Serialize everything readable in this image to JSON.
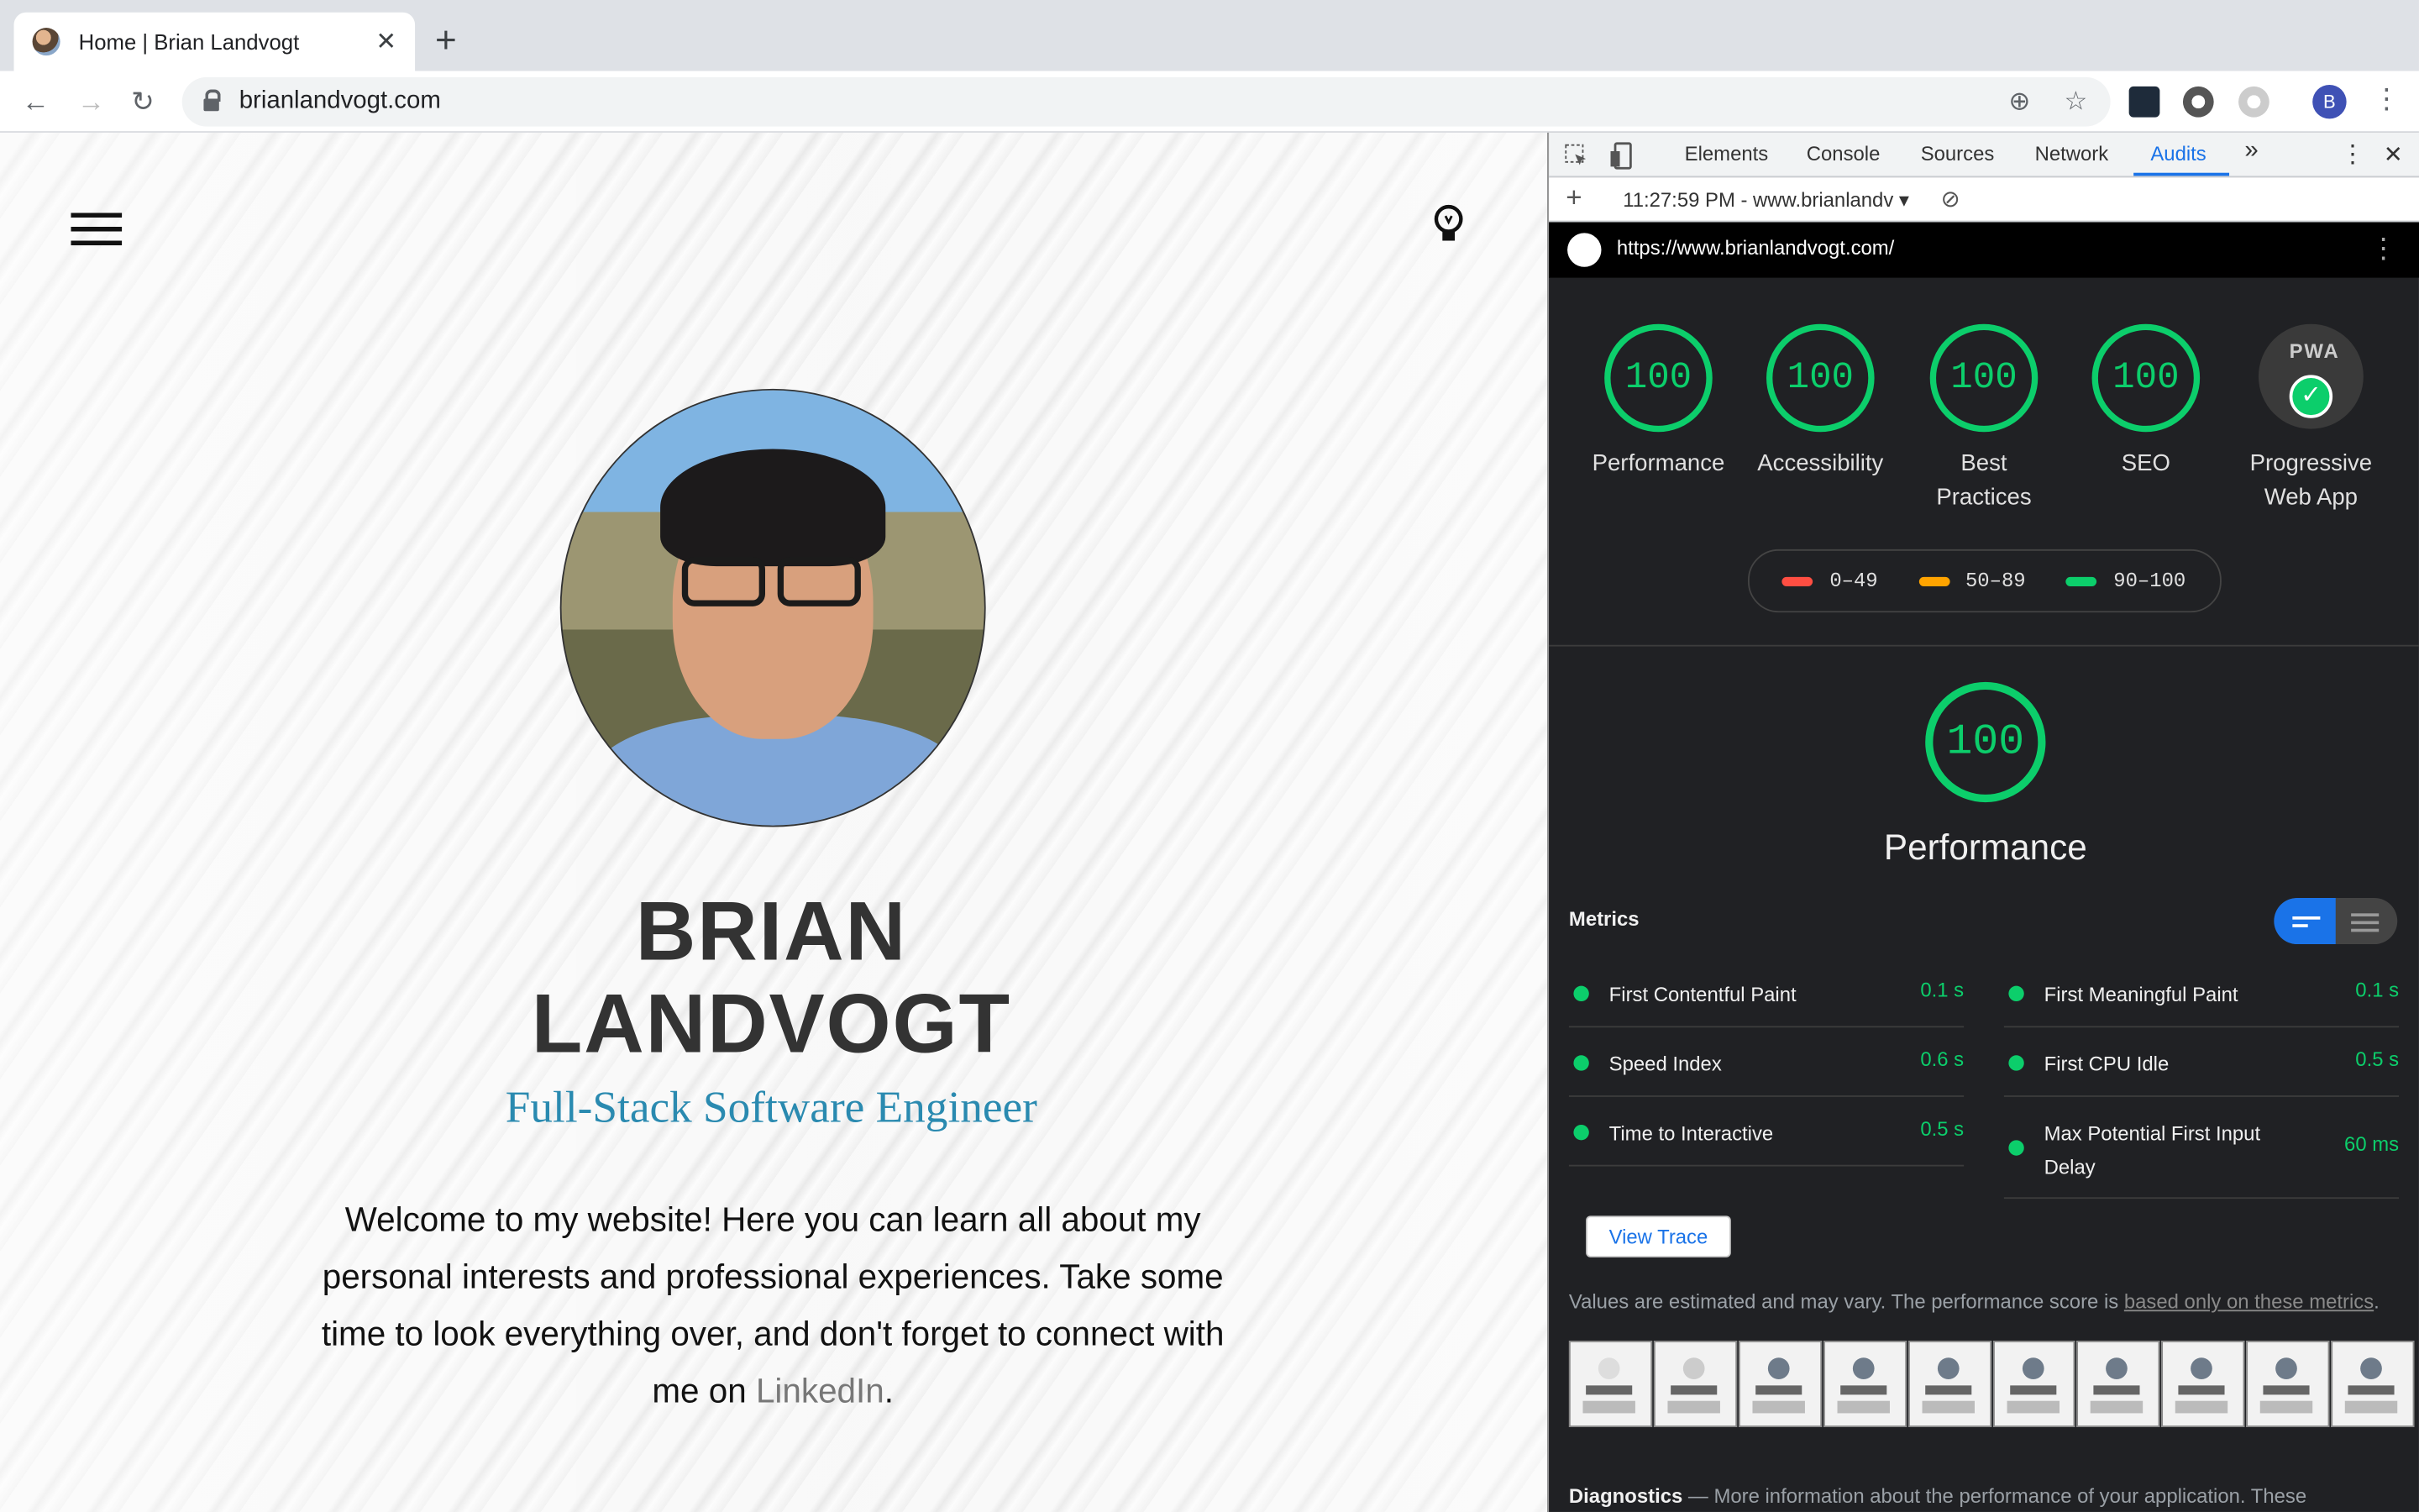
{
  "browser": {
    "tab_title": "Home | Brian Landvogt",
    "url": "brianlandvogt.com",
    "profile_initial": "B"
  },
  "site": {
    "name_line1": "BRIAN",
    "name_line2": "LANDVOGT",
    "role": "Full-Stack Software Engineer",
    "welcome_text": "Welcome to my website! Here you can learn all about my personal interests and professional experiences. Take some time to look everything over, and don't forget to connect with me on",
    "linkedin_label": "LinkedIn",
    "period": "."
  },
  "devtools": {
    "tabs": [
      "Elements",
      "Console",
      "Sources",
      "Network",
      "Audits"
    ],
    "active_tab": "Audits",
    "more": "»",
    "report_selector": "11:27:59 PM - www.brianlandv",
    "report_url": "https://www.brianlandvogt.com/",
    "scores": [
      {
        "label": "Performance",
        "value": "100"
      },
      {
        "label": "Accessibility",
        "value": "100"
      },
      {
        "label": "Best\nPractices",
        "value": "100"
      },
      {
        "label": "SEO",
        "value": "100"
      }
    ],
    "pwa": {
      "badge": "PWA",
      "label": "Progressive\nWeb App"
    },
    "legend": [
      {
        "range": "0–49",
        "color": "#ff4e42"
      },
      {
        "range": "50–89",
        "color": "#ffa400"
      },
      {
        "range": "90–100",
        "color": "#0cce6b"
      }
    ],
    "performance_score": "100",
    "performance_title": "Performance",
    "metrics_heading": "Metrics",
    "metrics_left": [
      {
        "label": "First Contentful Paint",
        "value": "0.1 s"
      },
      {
        "label": "Speed Index",
        "value": "0.6 s"
      },
      {
        "label": "Time to Interactive",
        "value": "0.5 s"
      }
    ],
    "metrics_right": [
      {
        "label": "First Meaningful Paint",
        "value": "0.1 s"
      },
      {
        "label": "First CPU Idle",
        "value": "0.5 s"
      },
      {
        "label": "Max Potential First Input Delay",
        "value": "60 ms"
      }
    ],
    "view_trace": "View Trace",
    "note_text": "Values are estimated and may vary. The performance score is",
    "note_link": "based only on these metrics",
    "note_end": ".",
    "diagnostics_heading": "Diagnostics",
    "diagnostics_dash": "—",
    "diagnostics_text": "More information about the performance of your application. These",
    "colors": {
      "pass": "#0cce6b",
      "accent": "#1a73e8"
    }
  }
}
